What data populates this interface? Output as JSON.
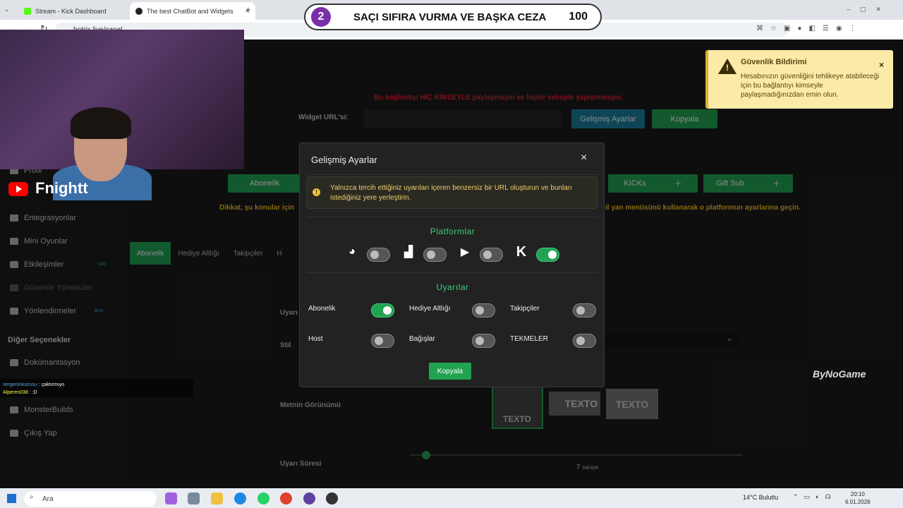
{
  "browser": {
    "tabs": [
      {
        "label": "Stream - Kick Dashboard"
      },
      {
        "label": "The best ChatBot and Widgets"
      }
    ],
    "url": "botrix.live/panel"
  },
  "overlay": {
    "number": "2",
    "text": "SAÇI SIFIRA VURMA VE BAŞKA CEZA",
    "score": "100"
  },
  "streamer": {
    "channel": "Fnightt"
  },
  "sidebar": {
    "items": [
      {
        "label": "Profil",
        "icon": "user-icon"
      },
      {
        "label": "Entegrasyonlar",
        "icon": "plug-icon"
      },
      {
        "label": "Mini Oyunlar",
        "icon": "gamepad-icon"
      },
      {
        "label": "Etkileşimler",
        "icon": "music-icon",
        "badge": "YENİ"
      },
      {
        "label": "Güvenilir Yöneticiler",
        "icon": "shield-icon"
      },
      {
        "label": "Yönlendirmeler",
        "icon": "users-icon",
        "badge": "BETA"
      }
    ],
    "other_heading": "Diğer Seçenekler",
    "other_items": [
      {
        "label": "Dokümantasyon"
      },
      {
        "label": "MonsterBuilds"
      },
      {
        "label": "Çıkış Yap"
      }
    ]
  },
  "background": {
    "warning": "Bu bağlantıyı HİÇ KİMSEYLE paylaşmayın ve hiçbir sebeple yapıştırmayın.",
    "widget_label": "Widget URL'si:",
    "advanced_btn": "Gelişmiş Ayarlar",
    "copy_btn": "Kopyala",
    "abonelik_btn": "Abonelik",
    "kicks_btn": "KICKs",
    "giftsub_btn": "Gift Sub",
    "notice_left": "Dikkat, şu konular için",
    "notice_right": "il yan menüsünü kullanarak o platformun ayarlarına geçin.",
    "tabs": [
      "Abonelik",
      "Hediye Altlığı",
      "Takipçiler",
      "H"
    ],
    "labels": {
      "uyari": "Uyarı",
      "stil": "Stil",
      "metin": "Metnin Görünümü",
      "sure": "Uyarı Süresi"
    },
    "texto": "TEXTO",
    "seconds_value": "7",
    "seconds_unit": "saniye"
  },
  "modal": {
    "title": "Gelişmiş Ayarlar",
    "info": "Yalnızca tercih ettiğiniz uyarıları içeren benzersiz bir URL oluşturun ve bunları istediğiniz yere yerleştirin.",
    "platforms_title": "Platformlar",
    "platforms": [
      {
        "icon": "botrix-icon",
        "enabled": false
      },
      {
        "icon": "twitch-icon",
        "enabled": false
      },
      {
        "icon": "youtube-icon",
        "enabled": false
      },
      {
        "icon": "kick-icon",
        "enabled": true
      }
    ],
    "alerts_title": "Uyarılar",
    "alerts": [
      {
        "label": "Abonelik",
        "enabled": true
      },
      {
        "label": "Hediye Altlığı",
        "enabled": false
      },
      {
        "label": "Takipçiler",
        "enabled": false
      },
      {
        "label": "Host",
        "enabled": false
      },
      {
        "label": "Bağışlar",
        "enabled": false
      },
      {
        "label": "TEKMELER",
        "enabled": false
      }
    ],
    "copy_label": "Kopyala"
  },
  "notification": {
    "title": "Güvenlik Bildirimi",
    "body": "Hesabınızın güvenliğini tehlikeye atabileceği için bu bağlantıyı kimseyle paylaşmadığınızdan emin olun."
  },
  "chat": {
    "line1_user": "sergeninkuzusu",
    "line1_msg": ": çaktırmıyo",
    "line2_user": "Alperen038",
    "line2_msg": ": :D"
  },
  "watermark": "ByNoGame",
  "taskbar": {
    "search": "Ara",
    "weather": "14°C  Bulutlu",
    "time": "20:10",
    "date": "6.01.2026"
  },
  "colors": {
    "accent": "#22a352",
    "teal": "#1b7f9e",
    "warning": "#fbeaa8"
  }
}
